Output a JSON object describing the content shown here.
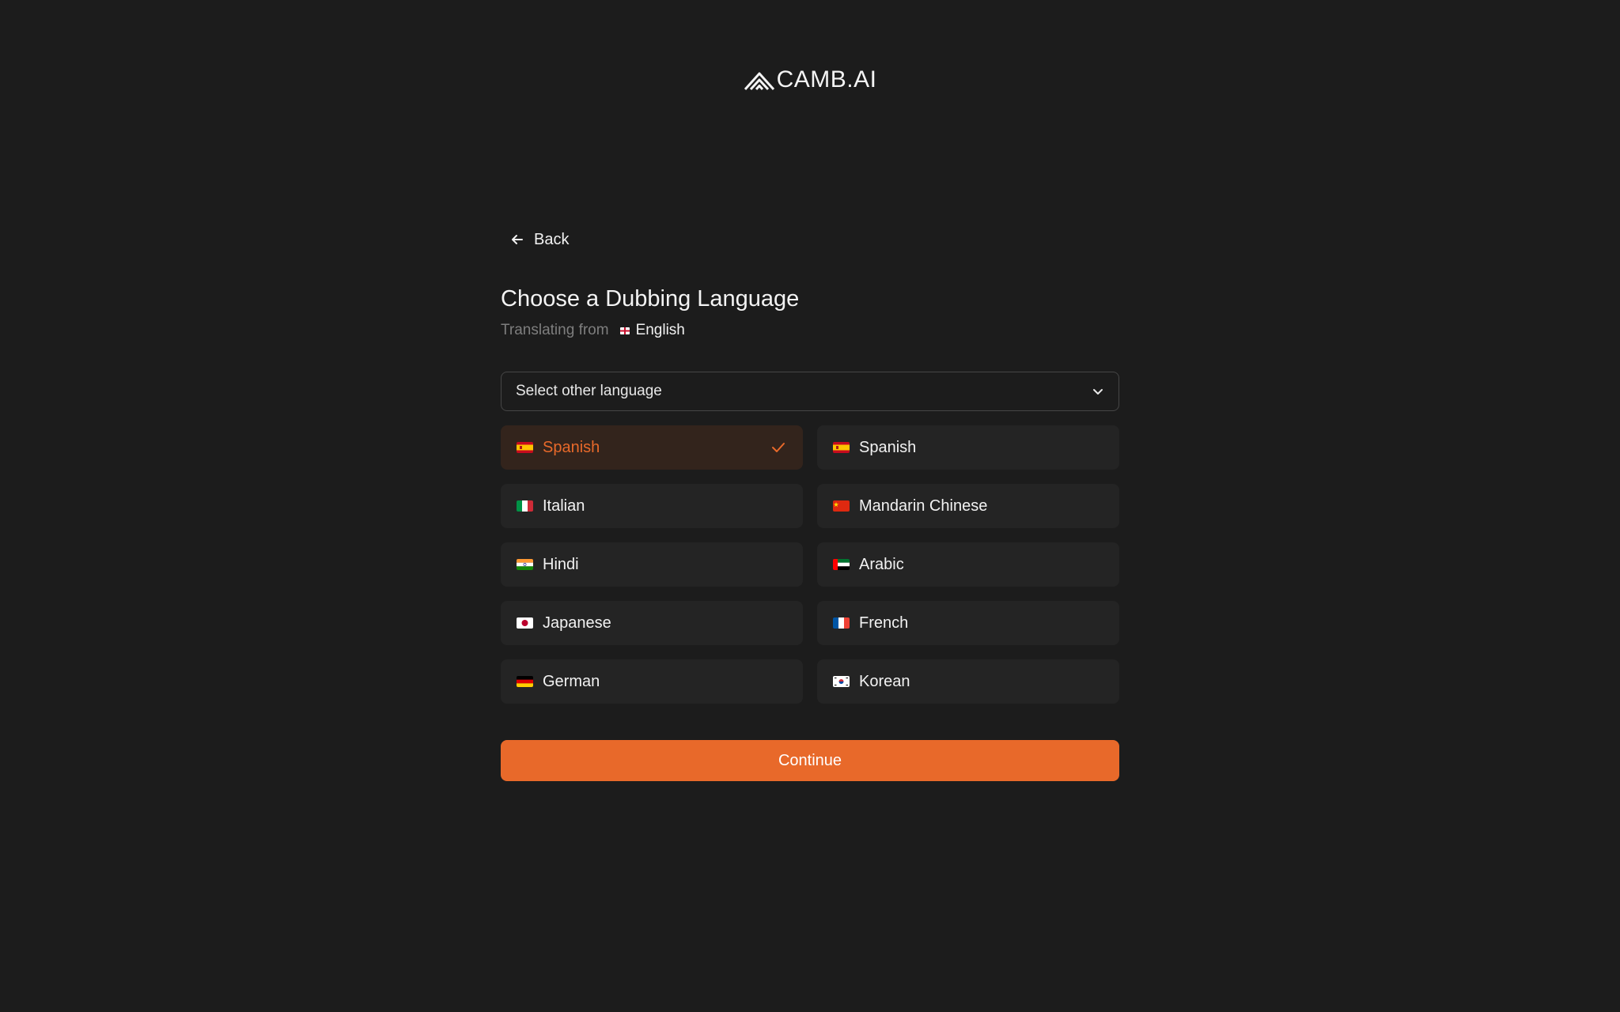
{
  "brand": {
    "logo_text": "CAMB.AI"
  },
  "nav": {
    "back_label": "Back"
  },
  "heading": {
    "title": "Choose a Dubbing Language",
    "subtitle_prefix": "Translating from",
    "source_language": "English"
  },
  "language_select": {
    "placeholder": "Select other language"
  },
  "languages": [
    {
      "label": "Spanish",
      "flag": "es",
      "selected": true
    },
    {
      "label": "Spanish",
      "flag": "es",
      "selected": false
    },
    {
      "label": "Italian",
      "flag": "it",
      "selected": false
    },
    {
      "label": "Mandarin Chinese",
      "flag": "cn",
      "selected": false
    },
    {
      "label": "Hindi",
      "flag": "in",
      "selected": false
    },
    {
      "label": "Arabic",
      "flag": "ae",
      "selected": false
    },
    {
      "label": "Japanese",
      "flag": "jp",
      "selected": false
    },
    {
      "label": "French",
      "flag": "fr",
      "selected": false
    },
    {
      "label": "German",
      "flag": "de",
      "selected": false
    },
    {
      "label": "Korean",
      "flag": "kr",
      "selected": false
    }
  ],
  "actions": {
    "continue_label": "Continue"
  },
  "colors": {
    "background": "#1c1c1c",
    "accent": "#e8692a",
    "card": "#242424",
    "card_selected": "#33241c",
    "muted_text": "#7e7e7e"
  },
  "icons": {
    "logo": "camb-chevron-logo-icon",
    "back": "arrow-left-icon",
    "dropdown": "chevron-down-icon",
    "selected": "check-icon"
  }
}
